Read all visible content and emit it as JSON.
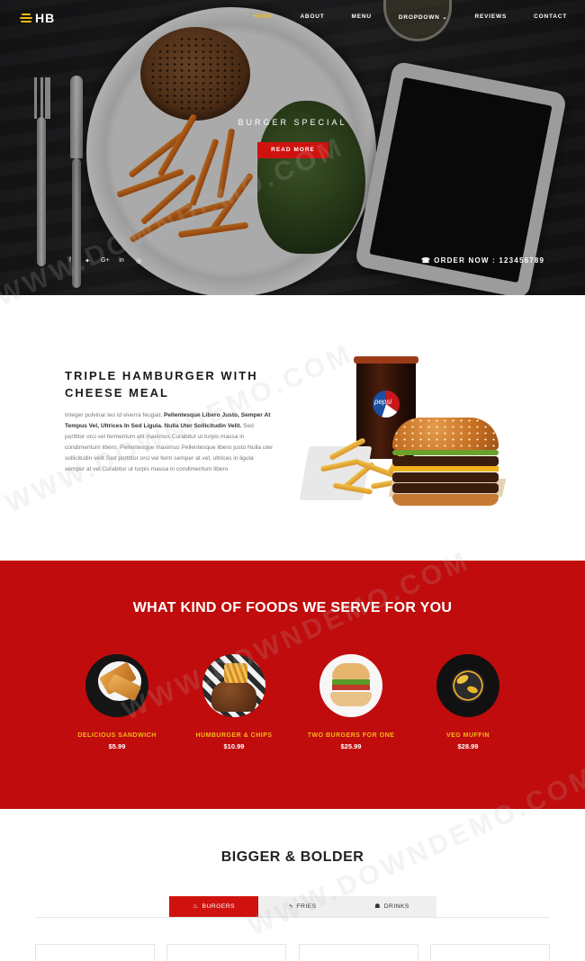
{
  "nav": {
    "logo_text": "HB",
    "links": [
      {
        "label": "HOME",
        "active": true
      },
      {
        "label": "ABOUT",
        "active": false
      },
      {
        "label": "MENU",
        "active": false
      },
      {
        "label": "DROPDOWN",
        "active": false,
        "has_caret": true
      },
      {
        "label": "REVIEWS",
        "active": false
      },
      {
        "label": "CONTACT",
        "active": false
      }
    ],
    "caret": "⌄"
  },
  "hero": {
    "caption": "BURGER SPECIAL",
    "button_label": "READ MORE",
    "social_icons": [
      {
        "icon": "facebook-icon",
        "glyph": "f"
      },
      {
        "icon": "twitter-icon",
        "glyph": "✦"
      },
      {
        "icon": "google-plus-icon",
        "glyph": "G+"
      },
      {
        "icon": "linkedin-icon",
        "glyph": "in"
      },
      {
        "icon": "instagram-icon",
        "glyph": "◎"
      }
    ],
    "phone_icon": "☎",
    "order_text": "ORDER NOW : 123456789"
  },
  "intro": {
    "title_line1": "TRIPLE HAMBURGER WITH",
    "title_line2": "CHEESE MEAL",
    "text_part1": "Integer pulvinar leo id viverra feugiat. ",
    "text_bold": "Pellentesque Libero Justo, Semper At Tempus Vel, Ultrices In Sed Ligula. Nulla Uter Sollicitudin Velit.",
    "text_part2": " Sed porttitor orci vel fermentum elit maximus Curabitur ut turpis massa in condimentum libero. Pellentesque maximus Pellentesque libero justo Nulla uter sollicitudin velit Sed porttitor orci vel ferm semper at vel, ultrices in ligula semper at vel Curabitur ut turpis massa in condimentum libero",
    "cup_brand": "pepsi"
  },
  "foods": {
    "title": "WHAT KIND OF FOODS WE SERVE FOR YOU",
    "items": [
      {
        "name": "DELICIOUS SANDWICH",
        "price": "$5.99"
      },
      {
        "name": "HUMBURGER & CHIPS",
        "price": "$10.99"
      },
      {
        "name": "TWO BURGERS FOR ONE",
        "price": "$25.99"
      },
      {
        "name": "VEG MUFFIN",
        "price": "$28.99"
      }
    ]
  },
  "menu": {
    "title": "BIGGER & BOLDER",
    "tabs": [
      {
        "label": "BURGERS",
        "icon": "burger-icon",
        "glyph": "♨",
        "active": true
      },
      {
        "label": "FRIES",
        "icon": "fries-icon",
        "glyph": "ϟ",
        "active": false
      },
      {
        "label": "DRINKS",
        "icon": "drinks-icon",
        "glyph": "☗",
        "active": false
      }
    ]
  },
  "watermark": "WWW.DOWNDEMO.COM",
  "colors": {
    "accent_red": "#d0120f",
    "section_red": "#c00c0c",
    "accent_yellow": "#f5b915"
  }
}
